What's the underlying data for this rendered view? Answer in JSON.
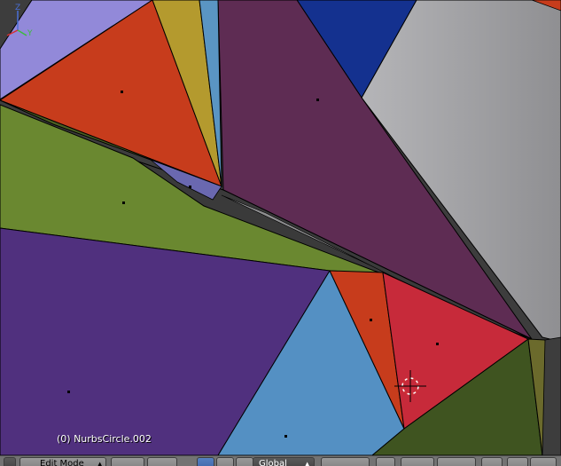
{
  "viewport": {
    "object_label": "(0) NurbsCircle.002",
    "axes": {
      "x": "X",
      "y": "Y",
      "z": "Z"
    }
  },
  "header": {
    "mode_label": "Edit Mode",
    "orientation_label": "Global"
  },
  "colors": {
    "lavender": "#9289d9",
    "orange": "#c73c1c",
    "mustard": "#b49a2e",
    "steel_blue": "#5a95c3",
    "plum": "#5e2c53",
    "navy": "#14318f",
    "gray": "#a5a5a7",
    "olive_green": "#6a8830",
    "purple": "#50307e",
    "light_blue": "#5490c3",
    "crimson": "#c72a3a",
    "dark_green": "#3f5420",
    "background": "#3d3d3d"
  }
}
